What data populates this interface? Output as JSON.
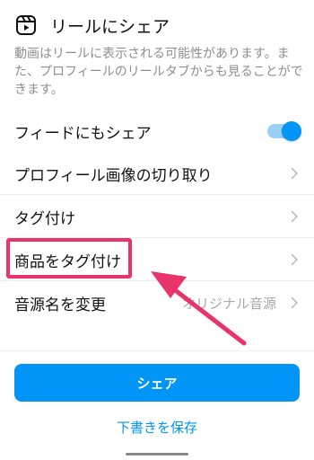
{
  "header": {
    "title": "リールにシェア",
    "description": "動画はリールに表示される可能性があります。また、プロフィールのリールタブからも見ることができます。",
    "icon": "reels-icon"
  },
  "settings": [
    {
      "label": "フィードにもシェア",
      "control": "toggle",
      "on": true
    },
    {
      "label": "プロフィール画像の切り取り",
      "control": "chevron-right-icon"
    },
    {
      "label": "タグ付け",
      "control": "chevron-right-icon"
    },
    {
      "label": "商品をタグ付け",
      "control": "chevron-right-icon",
      "highlighted": true
    },
    {
      "label": "音源名を変更",
      "value": "オリジナル音源",
      "control": "chevron-right-icon"
    }
  ],
  "actions": {
    "share_label": "シェア",
    "save_draft_label": "下書きを保存"
  },
  "colors": {
    "accent": "#0095f6",
    "toggle_track": "#9ccff5",
    "annotation": "#e8336b",
    "muted_text": "#8e8e8e"
  }
}
